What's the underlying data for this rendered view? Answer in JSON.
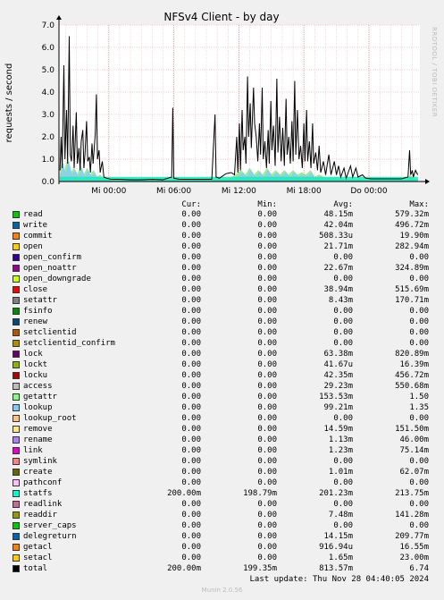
{
  "chart_data": {
    "type": "line",
    "title": "NFSv4 Client - by day",
    "ylabel": "requests / second",
    "side_text": "RRDTOOL / TOBI OETIKER",
    "ylim": [
      0,
      7
    ],
    "yticks": [
      "0.0",
      "1.0",
      "2.0",
      "3.0",
      "4.0",
      "5.0",
      "6.0",
      "7.0"
    ],
    "xticks": [
      {
        "label": "Mi 00:00",
        "x": 0
      },
      {
        "label": "Mi 06:00",
        "x": 6
      },
      {
        "label": "Mi 12:00",
        "x": 12
      },
      {
        "label": "Mi 18:00",
        "x": 18
      },
      {
        "label": "Do 00:00",
        "x": 24
      }
    ],
    "xlim": [
      -4.6,
      28.7
    ],
    "grid": true,
    "total_series": {
      "name": "total",
      "points": [
        [
          -4.5,
          0.5
        ],
        [
          -4.4,
          2.0
        ],
        [
          -4.3,
          0.6
        ],
        [
          -4.15,
          5.2
        ],
        [
          -4.05,
          1.0
        ],
        [
          -3.9,
          3.2
        ],
        [
          -3.8,
          0.8
        ],
        [
          -3.65,
          6.5
        ],
        [
          -3.55,
          1.2
        ],
        [
          -3.45,
          0.9
        ],
        [
          -3.3,
          2.5
        ],
        [
          -3.2,
          0.6
        ],
        [
          -3.0,
          3.1
        ],
        [
          -2.9,
          0.8
        ],
        [
          -2.75,
          1.5
        ],
        [
          -2.65,
          0.5
        ],
        [
          -2.55,
          1.8
        ],
        [
          -2.4,
          2.3
        ],
        [
          -2.3,
          0.6
        ],
        [
          -2.2,
          1.2
        ],
        [
          -2.05,
          2.7
        ],
        [
          -1.95,
          0.9
        ],
        [
          -1.8,
          1.1
        ],
        [
          -1.7,
          0.4
        ],
        [
          -1.55,
          1.7
        ],
        [
          -1.45,
          0.8
        ],
        [
          -1.25,
          2.1
        ],
        [
          -1.15,
          3.9
        ],
        [
          -1.05,
          1.0
        ],
        [
          -0.9,
          1.4
        ],
        [
          -0.8,
          0.4
        ],
        [
          -0.6,
          0.9
        ],
        [
          -0.45,
          0.2
        ],
        [
          -0.2,
          0.15
        ],
        [
          0.2,
          0.1
        ],
        [
          1.0,
          0.1
        ],
        [
          2.0,
          0.08
        ],
        [
          3.0,
          0.08
        ],
        [
          4.0,
          0.1
        ],
        [
          5.0,
          0.08
        ],
        [
          5.8,
          0.2
        ],
        [
          5.9,
          3.3
        ],
        [
          6.0,
          0.15
        ],
        [
          6.5,
          0.1
        ],
        [
          7.5,
          0.1
        ],
        [
          8.5,
          0.1
        ],
        [
          9.5,
          0.1
        ],
        [
          9.8,
          3.0
        ],
        [
          9.9,
          0.2
        ],
        [
          10.2,
          0.15
        ],
        [
          10.8,
          0.35
        ],
        [
          11.3,
          0.4
        ],
        [
          11.6,
          0.3
        ],
        [
          11.8,
          2.0
        ],
        [
          11.9,
          0.4
        ],
        [
          12.05,
          2.6
        ],
        [
          12.15,
          0.5
        ],
        [
          12.3,
          3.2
        ],
        [
          12.4,
          1.4
        ],
        [
          12.55,
          2.0
        ],
        [
          12.65,
          0.8
        ],
        [
          12.8,
          4.7
        ],
        [
          12.9,
          2.0
        ],
        [
          13.05,
          3.5
        ],
        [
          13.15,
          1.5
        ],
        [
          13.35,
          4.2
        ],
        [
          13.45,
          2.6
        ],
        [
          13.6,
          2.0
        ],
        [
          13.75,
          0.9
        ],
        [
          13.9,
          2.6
        ],
        [
          14.0,
          1.2
        ],
        [
          14.15,
          4.2
        ],
        [
          14.25,
          1.0
        ],
        [
          14.4,
          1.8
        ],
        [
          14.55,
          0.6
        ],
        [
          14.7,
          2.3
        ],
        [
          14.8,
          0.8
        ],
        [
          14.95,
          3.6
        ],
        [
          15.05,
          1.4
        ],
        [
          15.2,
          2.5
        ],
        [
          15.35,
          0.7
        ],
        [
          15.5,
          4.6
        ],
        [
          15.6,
          1.3
        ],
        [
          15.75,
          2.9
        ],
        [
          15.9,
          0.9
        ],
        [
          16.05,
          2.4
        ],
        [
          16.2,
          0.7
        ],
        [
          16.35,
          3.7
        ],
        [
          16.45,
          1.2
        ],
        [
          16.6,
          2.0
        ],
        [
          16.75,
          0.8
        ],
        [
          16.9,
          2.7
        ],
        [
          17.0,
          0.9
        ],
        [
          17.15,
          4.5
        ],
        [
          17.25,
          1.2
        ],
        [
          17.4,
          3.2
        ],
        [
          17.55,
          1.0
        ],
        [
          17.7,
          1.6
        ],
        [
          17.85,
          0.6
        ],
        [
          18.0,
          2.6
        ],
        [
          18.1,
          0.9
        ],
        [
          18.25,
          3.2
        ],
        [
          18.35,
          0.9
        ],
        [
          18.5,
          1.8
        ],
        [
          18.65,
          0.6
        ],
        [
          18.8,
          2.6
        ],
        [
          18.9,
          0.8
        ],
        [
          19.1,
          1.3
        ],
        [
          19.25,
          0.5
        ],
        [
          19.4,
          1.6
        ],
        [
          19.55,
          0.4
        ],
        [
          19.8,
          0.9
        ],
        [
          20.0,
          0.3
        ],
        [
          20.3,
          1.2
        ],
        [
          20.5,
          0.3
        ],
        [
          20.8,
          0.9
        ],
        [
          21.0,
          0.3
        ],
        [
          21.2,
          0.7
        ],
        [
          21.4,
          0.2
        ],
        [
          21.7,
          0.6
        ],
        [
          21.9,
          0.15
        ],
        [
          22.3,
          0.7
        ],
        [
          22.5,
          0.2
        ],
        [
          22.8,
          0.6
        ],
        [
          23.0,
          0.2
        ],
        [
          23.4,
          0.3
        ],
        [
          23.7,
          0.15
        ],
        [
          24.2,
          0.12
        ],
        [
          25.0,
          0.12
        ],
        [
          26.0,
          0.12
        ],
        [
          27.0,
          0.12
        ],
        [
          27.6,
          0.2
        ],
        [
          27.75,
          1.4
        ],
        [
          27.85,
          0.3
        ],
        [
          28.0,
          0.5
        ],
        [
          28.1,
          0.2
        ],
        [
          28.3,
          0.5
        ],
        [
          28.5,
          0.3
        ]
      ]
    },
    "area_series": [
      {
        "name": "getattr",
        "color": "#88e888",
        "points": [
          [
            -4.5,
            0.3
          ],
          [
            -4.3,
            0.9
          ],
          [
            -4.1,
            0.4
          ],
          [
            -3.8,
            1.0
          ],
          [
            -3.5,
            0.4
          ],
          [
            -3.2,
            0.6
          ],
          [
            -2.9,
            0.3
          ],
          [
            -2.6,
            0.7
          ],
          [
            -2.3,
            0.3
          ],
          [
            -2.0,
            0.6
          ],
          [
            -1.7,
            0.3
          ],
          [
            -1.4,
            0.5
          ],
          [
            -1.1,
            0.2
          ],
          [
            -0.8,
            0.3
          ],
          [
            -0.5,
            0.1
          ],
          [
            0.0,
            0.05
          ],
          [
            6.0,
            0.05
          ],
          [
            11.0,
            0.1
          ],
          [
            11.7,
            0.3
          ],
          [
            12.2,
            0.5
          ],
          [
            12.6,
            0.3
          ],
          [
            13.0,
            0.6
          ],
          [
            13.4,
            0.3
          ],
          [
            13.8,
            0.5
          ],
          [
            14.2,
            0.3
          ],
          [
            14.6,
            0.6
          ],
          [
            15.0,
            0.3
          ],
          [
            15.4,
            0.5
          ],
          [
            15.8,
            0.3
          ],
          [
            16.2,
            0.5
          ],
          [
            16.6,
            0.3
          ],
          [
            17.0,
            0.5
          ],
          [
            17.4,
            0.3
          ],
          [
            17.8,
            0.4
          ],
          [
            18.2,
            0.3
          ],
          [
            18.6,
            0.5
          ],
          [
            19.0,
            0.2
          ],
          [
            19.4,
            0.3
          ],
          [
            20.0,
            0.15
          ],
          [
            21.0,
            0.15
          ],
          [
            22.0,
            0.1
          ],
          [
            23.0,
            0.1
          ],
          [
            24.0,
            0.05
          ],
          [
            27.5,
            0.05
          ],
          [
            27.8,
            0.3
          ],
          [
            28.1,
            0.1
          ],
          [
            28.5,
            0.1
          ]
        ]
      },
      {
        "name": "lookup",
        "color": "#89cef5",
        "points": [
          [
            -4.5,
            0.2
          ],
          [
            -4.2,
            0.8
          ],
          [
            -4.0,
            0.3
          ],
          [
            -3.7,
            0.9
          ],
          [
            -3.4,
            0.3
          ],
          [
            -3.1,
            0.5
          ],
          [
            -2.8,
            0.2
          ],
          [
            -2.5,
            0.6
          ],
          [
            -2.2,
            0.2
          ],
          [
            -1.9,
            0.5
          ],
          [
            -1.6,
            0.2
          ],
          [
            -1.3,
            0.4
          ],
          [
            -1.0,
            0.1
          ],
          [
            -0.6,
            0.2
          ],
          [
            0.0,
            0.03
          ],
          [
            11.0,
            0.05
          ],
          [
            11.8,
            0.2
          ],
          [
            12.3,
            0.4
          ],
          [
            12.7,
            0.2
          ],
          [
            13.1,
            0.5
          ],
          [
            13.5,
            0.2
          ],
          [
            13.9,
            0.4
          ],
          [
            14.3,
            0.2
          ],
          [
            14.7,
            0.5
          ],
          [
            15.1,
            0.2
          ],
          [
            15.5,
            0.4
          ],
          [
            15.9,
            0.2
          ],
          [
            16.3,
            0.4
          ],
          [
            16.7,
            0.2
          ],
          [
            17.1,
            0.4
          ],
          [
            17.5,
            0.2
          ],
          [
            17.9,
            0.3
          ],
          [
            18.3,
            0.2
          ],
          [
            18.7,
            0.4
          ],
          [
            19.1,
            0.1
          ],
          [
            19.5,
            0.2
          ],
          [
            20.0,
            0.1
          ],
          [
            22.0,
            0.05
          ],
          [
            24.0,
            0.03
          ],
          [
            27.5,
            0.03
          ],
          [
            27.8,
            0.2
          ],
          [
            28.1,
            0.05
          ],
          [
            28.5,
            0.05
          ]
        ]
      },
      {
        "name": "statfs",
        "color": "#22e8b8",
        "points": [
          [
            -4.5,
            0.2
          ],
          [
            28.5,
            0.2
          ]
        ]
      }
    ]
  },
  "legend": {
    "headers": {
      "cur": "Cur:",
      "min": "Min:",
      "avg": "Avg:",
      "max": "Max:"
    },
    "rows": [
      {
        "name": "read",
        "color": "#00cc00",
        "cur": "0.00",
        "min": "0.00",
        "avg": "48.15m",
        "max": "579.32m"
      },
      {
        "name": "write",
        "color": "#0066b3",
        "cur": "0.00",
        "min": "0.00",
        "avg": "42.04m",
        "max": "496.72m"
      },
      {
        "name": "commit",
        "color": "#ff8000",
        "cur": "0.00",
        "min": "0.00",
        "avg": "508.33u",
        "max": "19.90m"
      },
      {
        "name": "open",
        "color": "#ffcc00",
        "cur": "0.00",
        "min": "0.00",
        "avg": "21.71m",
        "max": "282.94m"
      },
      {
        "name": "open_confirm",
        "color": "#330099",
        "cur": "0.00",
        "min": "0.00",
        "avg": "0.00",
        "max": "0.00"
      },
      {
        "name": "open_noattr",
        "color": "#990099",
        "cur": "0.00",
        "min": "0.00",
        "avg": "22.67m",
        "max": "324.89m"
      },
      {
        "name": "open_downgrade",
        "color": "#ccff00",
        "cur": "0.00",
        "min": "0.00",
        "avg": "0.00",
        "max": "0.00"
      },
      {
        "name": "close",
        "color": "#ff0000",
        "cur": "0.00",
        "min": "0.00",
        "avg": "38.94m",
        "max": "515.69m"
      },
      {
        "name": "setattr",
        "color": "#808080",
        "cur": "0.00",
        "min": "0.00",
        "avg": "8.43m",
        "max": "170.71m"
      },
      {
        "name": "fsinfo",
        "color": "#008f00",
        "cur": "0.00",
        "min": "0.00",
        "avg": "0.00",
        "max": "0.00"
      },
      {
        "name": "renew",
        "color": "#00487d",
        "cur": "0.00",
        "min": "0.00",
        "avg": "0.00",
        "max": "0.00"
      },
      {
        "name": "setclientid",
        "color": "#b35a00",
        "cur": "0.00",
        "min": "0.00",
        "avg": "0.00",
        "max": "0.00"
      },
      {
        "name": "setclientid_confirm",
        "color": "#b38f00",
        "cur": "0.00",
        "min": "0.00",
        "avg": "0.00",
        "max": "0.00"
      },
      {
        "name": "lock",
        "color": "#6b006b",
        "cur": "0.00",
        "min": "0.00",
        "avg": "63.38m",
        "max": "820.89m"
      },
      {
        "name": "lockt",
        "color": "#8fb300",
        "cur": "0.00",
        "min": "0.00",
        "avg": "41.67u",
        "max": "16.39m"
      },
      {
        "name": "locku",
        "color": "#b30000",
        "cur": "0.00",
        "min": "0.00",
        "avg": "42.35m",
        "max": "456.72m"
      },
      {
        "name": "access",
        "color": "#bebebe",
        "cur": "0.00",
        "min": "0.00",
        "avg": "29.23m",
        "max": "550.68m"
      },
      {
        "name": "getattr",
        "color": "#80ff80",
        "cur": "0.00",
        "min": "0.00",
        "avg": "153.53m",
        "max": "1.50"
      },
      {
        "name": "lookup",
        "color": "#80c9ff",
        "cur": "0.00",
        "min": "0.00",
        "avg": "99.21m",
        "max": "1.35"
      },
      {
        "name": "lookup_root",
        "color": "#ffc080",
        "cur": "0.00",
        "min": "0.00",
        "avg": "0.00",
        "max": "0.00"
      },
      {
        "name": "remove",
        "color": "#ffe680",
        "cur": "0.00",
        "min": "0.00",
        "avg": "14.59m",
        "max": "151.50m"
      },
      {
        "name": "rename",
        "color": "#aa80ff",
        "cur": "0.00",
        "min": "0.00",
        "avg": "1.13m",
        "max": "46.00m"
      },
      {
        "name": "link",
        "color": "#ee00cc",
        "cur": "0.00",
        "min": "0.00",
        "avg": "1.23m",
        "max": "75.14m"
      },
      {
        "name": "symlink",
        "color": "#ff8080",
        "cur": "0.00",
        "min": "0.00",
        "avg": "0.00",
        "max": "0.00"
      },
      {
        "name": "create",
        "color": "#666600",
        "cur": "0.00",
        "min": "0.00",
        "avg": "1.01m",
        "max": "62.07m"
      },
      {
        "name": "pathconf",
        "color": "#ffbfff",
        "cur": "0.00",
        "min": "0.00",
        "avg": "0.00",
        "max": "0.00"
      },
      {
        "name": "statfs",
        "color": "#00ffcc",
        "cur": "200.00m",
        "min": "198.79m",
        "avg": "201.23m",
        "max": "213.75m"
      },
      {
        "name": "readlink",
        "color": "#cc6699",
        "cur": "0.00",
        "min": "0.00",
        "avg": "0.00",
        "max": "0.00"
      },
      {
        "name": "readdir",
        "color": "#999900",
        "cur": "0.00",
        "min": "0.00",
        "avg": "7.48m",
        "max": "141.28m"
      },
      {
        "name": "server_caps",
        "color": "#00cc00",
        "cur": "0.00",
        "min": "0.00",
        "avg": "0.00",
        "max": "0.00"
      },
      {
        "name": "delegreturn",
        "color": "#0066b3",
        "cur": "0.00",
        "min": "0.00",
        "avg": "14.15m",
        "max": "209.77m"
      },
      {
        "name": "getacl",
        "color": "#ff8000",
        "cur": "0.00",
        "min": "0.00",
        "avg": "916.94u",
        "max": "16.55m"
      },
      {
        "name": "setacl",
        "color": "#ffcc00",
        "cur": "0.00",
        "min": "0.00",
        "avg": "1.65m",
        "max": "23.00m"
      },
      {
        "name": "total",
        "color": "#000000",
        "cur": "200.00m",
        "min": "199.35m",
        "avg": "813.57m",
        "max": "6.74"
      }
    ]
  },
  "footer": {
    "last_update": "Last update: Thu Nov 28 04:40:05 2024",
    "version": "Munin 2.0.56"
  }
}
